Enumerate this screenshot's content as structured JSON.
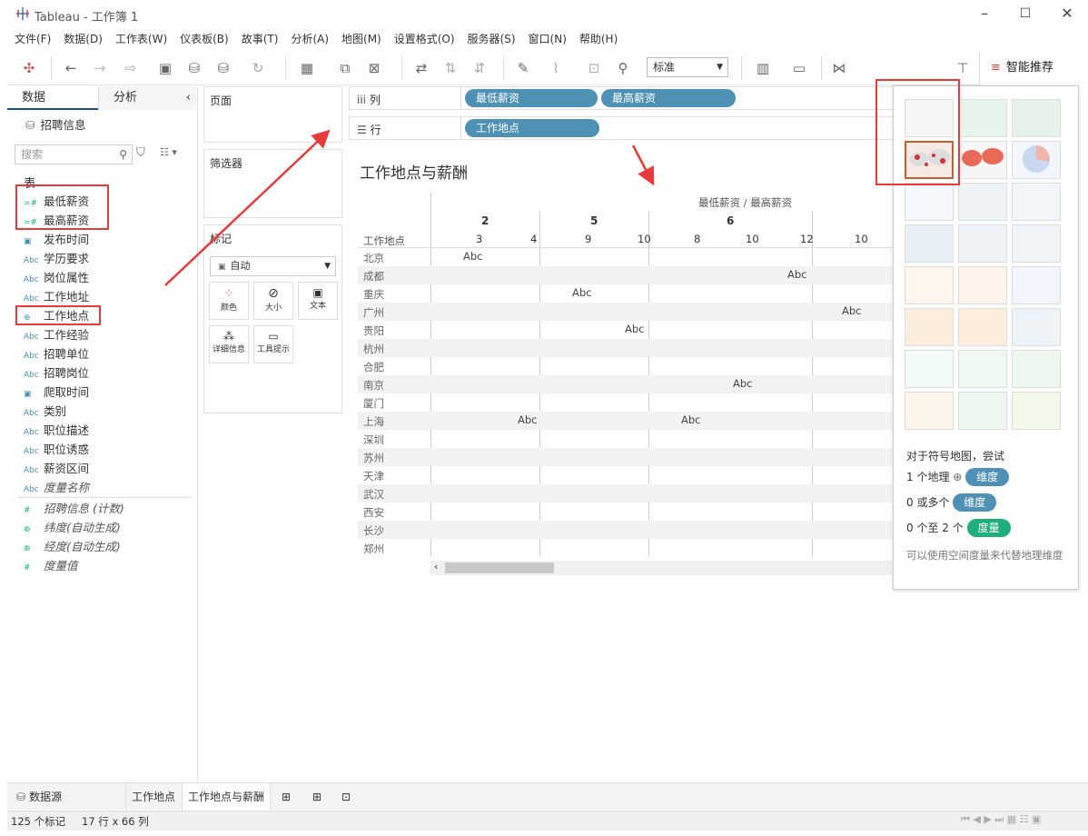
{
  "window": {
    "title": "Tableau - 工作簿 1"
  },
  "menu": [
    "文件(F)",
    "数据(D)",
    "工作表(W)",
    "仪表板(B)",
    "故事(T)",
    "分析(A)",
    "地图(M)",
    "设置格式(O)",
    "服务器(S)",
    "窗口(N)",
    "帮助(H)"
  ],
  "toolbar": {
    "fit_select": "标准",
    "showme_label": "智能推荐"
  },
  "data_pane": {
    "tab_data": "数据",
    "tab_analysis": "分析",
    "datasource": "招聘信息",
    "search_placeholder": "搜索",
    "section": "表",
    "fields": [
      {
        "icon": "=#",
        "label": "最低薪资",
        "type": "measure"
      },
      {
        "icon": "=#",
        "label": "最高薪资",
        "type": "measure"
      },
      {
        "icon": "date",
        "label": "发布时间",
        "type": "date"
      },
      {
        "icon": "Abc",
        "label": "学历要求",
        "type": "dim"
      },
      {
        "icon": "Abc",
        "label": "岗位属性",
        "type": "dim"
      },
      {
        "icon": "Abc",
        "label": "工作地址",
        "type": "dim"
      },
      {
        "icon": "globe",
        "label": "工作地点",
        "type": "geo"
      },
      {
        "icon": "Abc",
        "label": "工作经验",
        "type": "dim"
      },
      {
        "icon": "Abc",
        "label": "招聘单位",
        "type": "dim"
      },
      {
        "icon": "Abc",
        "label": "招聘岗位",
        "type": "dim"
      },
      {
        "icon": "date",
        "label": "爬取时间",
        "type": "date"
      },
      {
        "icon": "Abc",
        "label": "类别",
        "type": "dim"
      },
      {
        "icon": "Abc",
        "label": "职位描述",
        "type": "dim"
      },
      {
        "icon": "Abc",
        "label": "职位诱惑",
        "type": "dim"
      },
      {
        "icon": "Abc",
        "label": "薪资区间",
        "type": "dim"
      },
      {
        "icon": "Abc",
        "label": "度量名称",
        "type": "dim-italic"
      }
    ],
    "generated": [
      {
        "icon": "#",
        "label": "招聘信息 (计数)"
      },
      {
        "icon": "globe",
        "label": "纬度(自动生成)"
      },
      {
        "icon": "globe",
        "label": "经度(自动生成)"
      },
      {
        "icon": "#",
        "label": "度量值"
      }
    ]
  },
  "shelves": {
    "pages": "页面",
    "filters": "筛选器",
    "marks": "标记",
    "marks_type": "自动",
    "mark_buttons": [
      "颜色",
      "大小",
      "文本",
      "详细信息",
      "工具提示"
    ],
    "columns_label": "列",
    "rows_label": "行",
    "columns_pills": [
      "最低薪资",
      "最高薪资"
    ],
    "rows_pills": [
      "工作地点"
    ]
  },
  "view": {
    "title": "工作地点与薪酬",
    "header_top": "最低薪资 / 最高薪资",
    "row_header": "工作地点",
    "col_groups": [
      "2",
      "5",
      "6"
    ],
    "col_values": [
      "3",
      "4",
      "9",
      "10",
      "8",
      "10",
      "12",
      "10"
    ],
    "cities": [
      "北京",
      "成都",
      "重庆",
      "广州",
      "贵阳",
      "杭州",
      "合肥",
      "南京",
      "厦门",
      "上海",
      "深圳",
      "苏州",
      "天津",
      "武汉",
      "西安",
      "长沙",
      "郑州"
    ],
    "abc": "Abc"
  },
  "showme": {
    "hint": "对于符号地图，尝试",
    "req1": "1 个地理",
    "req1_pill": "维度",
    "req2": "0 或多个",
    "req2_pill": "维度",
    "req3": "0 个至 2 个",
    "req3_pill": "度量",
    "note": "可以使用空间度量来代替地理维度"
  },
  "tabs": {
    "datasource": "数据源",
    "sheet1": "工作地点",
    "sheet2": "工作地点与薪酬"
  },
  "status": {
    "marks": "125 个标记",
    "rowscols": "17 行 x 66 列"
  },
  "colors": {
    "pill": "#4e91b4",
    "measure_pill": "#1fae7c",
    "highlight": "#e83a3a"
  }
}
